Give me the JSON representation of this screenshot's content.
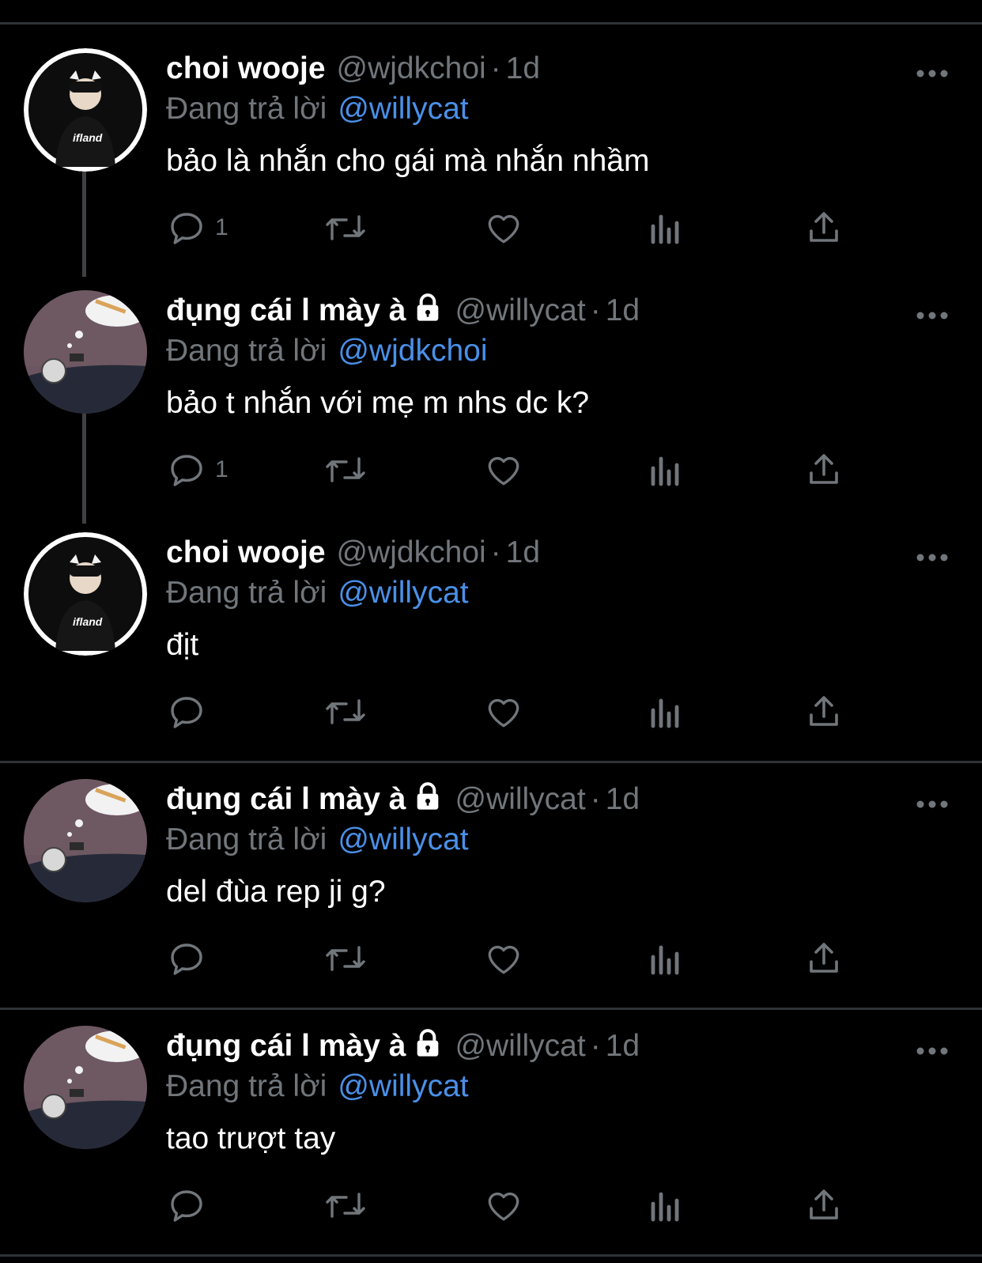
{
  "colors": {
    "background": "#000000",
    "text": "#ffffff",
    "muted": "#71767b",
    "link": "#4a90e8",
    "divider": "#2f3336"
  },
  "tweets": [
    {
      "name": "choi wooje",
      "locked": false,
      "handle": "@wjdkchoi",
      "dot": "·",
      "time": "1d",
      "reply_prefix": "Đang trả lời",
      "reply_to": "@willycat",
      "text": "bảo là nhắn cho gái mà nhắn nhầm",
      "reply_count": "1",
      "avatar": "avatar-wjdkchoi"
    },
    {
      "name": "đụng cái l mày à",
      "locked": true,
      "handle": "@willycat",
      "dot": "·",
      "time": "1d",
      "reply_prefix": "Đang trả lời",
      "reply_to": "@wjdkchoi",
      "text": "bảo t nhắn với mẹ m nhs dc k?",
      "reply_count": "1",
      "avatar": "avatar-willycat"
    },
    {
      "name": "choi wooje",
      "locked": false,
      "handle": "@wjdkchoi",
      "dot": "·",
      "time": "1d",
      "reply_prefix": "Đang trả lời",
      "reply_to": "@willycat",
      "text": "địt",
      "reply_count": "",
      "avatar": "avatar-wjdkchoi"
    },
    {
      "name": "đụng cái l mày à",
      "locked": true,
      "handle": "@willycat",
      "dot": "·",
      "time": "1d",
      "reply_prefix": "Đang trả lời",
      "reply_to": "@willycat",
      "text": "del đùa rep ji g?",
      "reply_count": "",
      "avatar": "avatar-willycat"
    },
    {
      "name": "đụng cái l mày à",
      "locked": true,
      "handle": "@willycat",
      "dot": "·",
      "time": "1d",
      "reply_prefix": "Đang trả lời",
      "reply_to": "@willycat",
      "text": "tao trượt tay",
      "reply_count": "",
      "avatar": "avatar-willycat"
    }
  ]
}
